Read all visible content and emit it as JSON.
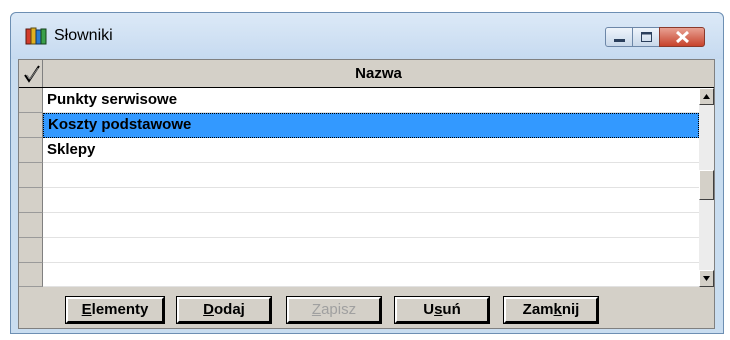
{
  "window": {
    "title": "Słowniki",
    "colors": {
      "selection": "#3399ff",
      "close_button": "#c7432c"
    }
  },
  "grid": {
    "header": {
      "check_icon": "checkmark-icon",
      "name_label": "Nazwa"
    },
    "rows": [
      {
        "name": "Punkty serwisowe",
        "selected": false
      },
      {
        "name": "Koszty podstawowe",
        "selected": true
      },
      {
        "name": "Sklepy",
        "selected": false
      },
      {
        "name": "",
        "selected": false
      },
      {
        "name": "",
        "selected": false
      },
      {
        "name": "",
        "selected": false
      },
      {
        "name": "",
        "selected": false
      },
      {
        "name": "",
        "selected": false
      }
    ]
  },
  "buttons": {
    "elementy": {
      "pre": "",
      "key": "E",
      "post": "lementy"
    },
    "dodaj": {
      "pre": "",
      "key": "D",
      "post": "odaj"
    },
    "zapisz": {
      "pre": "",
      "key": "Z",
      "post": "apisz"
    },
    "usun": {
      "pre": "U",
      "key": "s",
      "post": "uń"
    },
    "zamknij": {
      "pre": "Zam",
      "key": "k",
      "post": "nij"
    }
  }
}
